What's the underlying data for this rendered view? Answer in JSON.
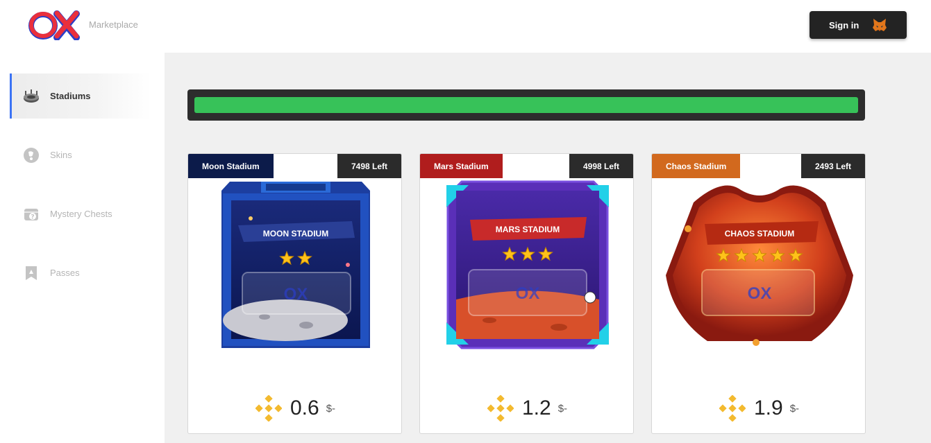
{
  "app": {
    "subtitle": "Marketplace"
  },
  "header": {
    "signin_label": "Sign in"
  },
  "sidebar": {
    "items": [
      {
        "label": "Stadiums",
        "icon": "stadium-icon",
        "active": true
      },
      {
        "label": "Skins",
        "icon": "skins-icon"
      },
      {
        "label": "Mystery Chests",
        "icon": "mystery-chest-icon"
      },
      {
        "label": "Passes",
        "icon": "pass-icon"
      }
    ]
  },
  "progress": {
    "fill_fraction": 1.0,
    "color": "#37c259"
  },
  "cards": [
    {
      "name": "Moon Stadium",
      "left": "7498 Left",
      "banner": "MOON STADIUM",
      "stars": 2,
      "price": "0.6",
      "usd": "$-",
      "tag_color": "#0c1b4a"
    },
    {
      "name": "Mars Stadium",
      "left": "4998 Left",
      "banner": "MARS STADIUM",
      "stars": 3,
      "price": "1.2",
      "usd": "$-",
      "tag_color": "#b01d1d"
    },
    {
      "name": "Chaos Stadium",
      "left": "2493 Left",
      "banner": "CHAOS STADIUM",
      "stars": 5,
      "price": "1.9",
      "usd": "$-",
      "tag_color": "#d2691e"
    }
  ],
  "colors": {
    "accent": "#3b73f5",
    "bnb": "#f3ba2f"
  }
}
